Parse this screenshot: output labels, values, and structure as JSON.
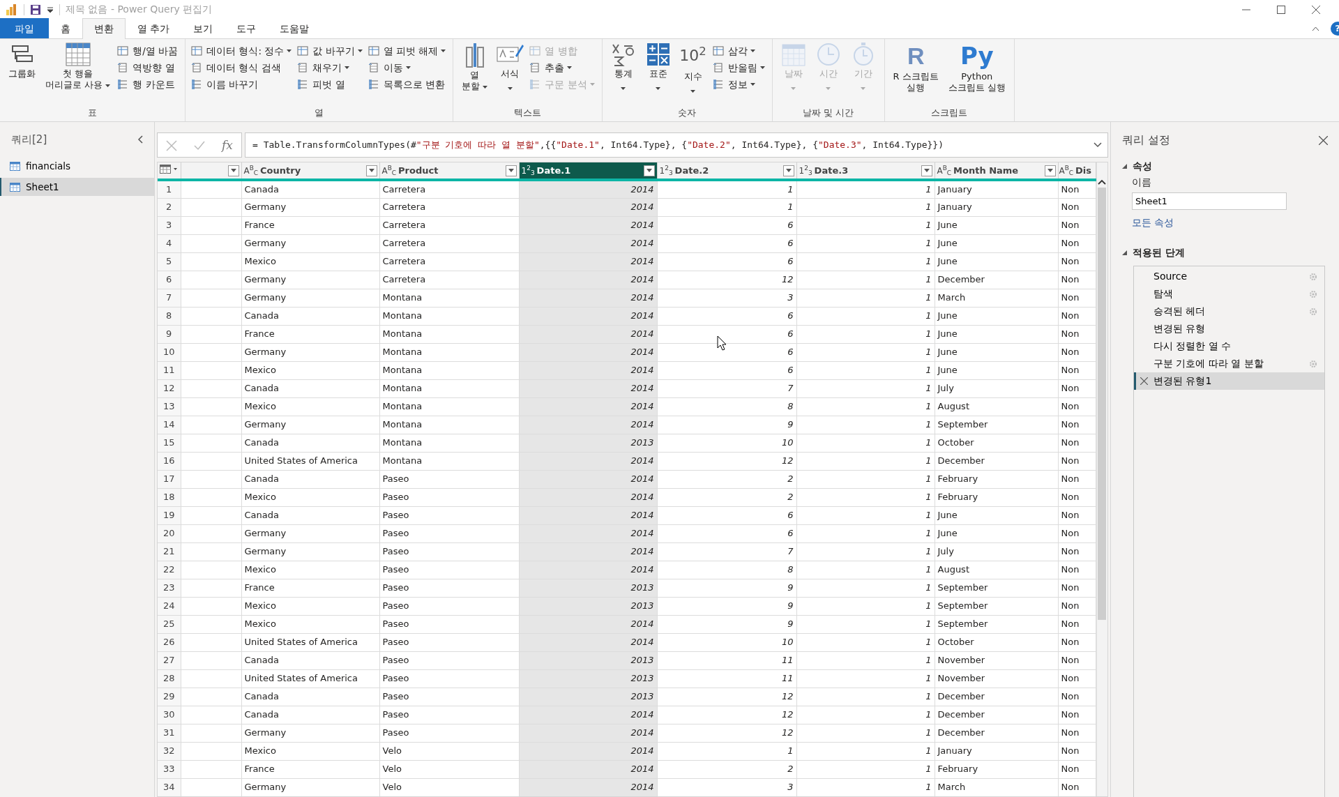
{
  "title_bar": {
    "title": "제목 없음 - Power Query 편집기"
  },
  "ribbon_tabs": [
    {
      "label": "파일",
      "kind": "file",
      "selected": false
    },
    {
      "label": "홈",
      "kind": "tab",
      "selected": false
    },
    {
      "label": "변환",
      "kind": "tab",
      "selected": true
    },
    {
      "label": "열 추가",
      "kind": "tab",
      "selected": false
    },
    {
      "label": "보기",
      "kind": "tab",
      "selected": false
    },
    {
      "label": "도구",
      "kind": "tab",
      "selected": false
    },
    {
      "label": "도움말",
      "kind": "tab",
      "selected": false
    }
  ],
  "help": "?",
  "ribbon_groups": [
    {
      "label": "표",
      "items": [
        {
          "kind": "large",
          "lines": [
            "그룹화"
          ],
          "dropdown": false,
          "disabled": false
        },
        {
          "kind": "large",
          "lines": [
            "첫 행을",
            "머리글로 사용"
          ],
          "dropdown": true,
          "disabled": false
        },
        {
          "kind": "stack",
          "items": [
            {
              "label": "행/열 바꿈",
              "dropdown": false,
              "disabled": false
            },
            {
              "label": "역방향 열",
              "dropdown": false,
              "disabled": false
            },
            {
              "label": "행 카운트",
              "dropdown": false,
              "disabled": false
            }
          ]
        }
      ]
    },
    {
      "label": "열",
      "items": [
        {
          "kind": "stack",
          "items": [
            {
              "label": "데이터 형식: 정수",
              "dropdown": true,
              "disabled": false
            },
            {
              "label": "데이터 형식 검색",
              "dropdown": false,
              "disabled": false
            },
            {
              "label": "이름 바꾸기",
              "dropdown": false,
              "disabled": false
            }
          ]
        },
        {
          "kind": "stack",
          "items": [
            {
              "label": "값 바꾸기",
              "dropdown": true,
              "disabled": false
            },
            {
              "label": "채우기",
              "dropdown": true,
              "disabled": false
            },
            {
              "label": "피벗 열",
              "dropdown": false,
              "disabled": false
            }
          ]
        },
        {
          "kind": "stack",
          "items": [
            {
              "label": "열 피벗 해제",
              "dropdown": true,
              "disabled": false
            },
            {
              "label": "이동",
              "dropdown": true,
              "disabled": false
            },
            {
              "label": "목록으로 변환",
              "dropdown": false,
              "disabled": false
            }
          ]
        }
      ]
    },
    {
      "label": "텍스트",
      "items": [
        {
          "kind": "large",
          "lines": [
            "열",
            "분할"
          ],
          "dropdown": true,
          "disabled": false
        },
        {
          "kind": "large",
          "lines": [
            "서식"
          ],
          "dropdown": true,
          "disabled": false
        },
        {
          "kind": "stack",
          "items": [
            {
              "label": "열 병합",
              "dropdown": false,
              "disabled": true
            },
            {
              "label": "추출",
              "dropdown": true,
              "disabled": false
            },
            {
              "label": "구문 분석",
              "dropdown": true,
              "disabled": true
            }
          ]
        }
      ]
    },
    {
      "label": "숫자",
      "items": [
        {
          "kind": "large",
          "lines": [
            "통계"
          ],
          "dropdown": true,
          "disabled": false
        },
        {
          "kind": "large",
          "lines": [
            "표준"
          ],
          "dropdown": true,
          "disabled": false
        },
        {
          "kind": "large",
          "lines": [
            "지수"
          ],
          "dropdown": true,
          "disabled": false,
          "icon_text": "10$^{2}$"
        },
        {
          "kind": "stack",
          "items": [
            {
              "label": "삼각",
              "dropdown": true,
              "disabled": false
            },
            {
              "label": "반올림",
              "dropdown": true,
              "disabled": false
            },
            {
              "label": "정보",
              "dropdown": true,
              "disabled": false
            }
          ]
        }
      ]
    },
    {
      "label": "날짜 및 시간",
      "items": [
        {
          "kind": "large",
          "lines": [
            "날짜"
          ],
          "dropdown": true,
          "disabled": true
        },
        {
          "kind": "large",
          "lines": [
            "시간"
          ],
          "dropdown": true,
          "disabled": true
        },
        {
          "kind": "large",
          "lines": [
            "기간"
          ],
          "dropdown": true,
          "disabled": true
        }
      ]
    },
    {
      "label": "스크립트",
      "items": [
        {
          "kind": "large",
          "lines": [
            "R 스크립트",
            "실행"
          ],
          "dropdown": false,
          "disabled": false,
          "icon_text": "R"
        },
        {
          "kind": "large",
          "lines": [
            "Python",
            "스크립트 실행"
          ],
          "dropdown": false,
          "disabled": false,
          "icon_text": "Py"
        }
      ]
    }
  ],
  "queries": {
    "title": "쿼리[2]",
    "items": [
      {
        "label": "financials",
        "selected": false
      },
      {
        "label": "Sheet1",
        "selected": true
      }
    ]
  },
  "formula_bar": {
    "fx": "fx",
    "formula": "= Table.TransformColumnTypes(#\"구분 기호에 따라 열 분할\",{{\"Date.1\", Int64.Type}, {\"Date.2\", Int64.Type}, {\"Date.3\", Int64.Type}})"
  },
  "table": {
    "columns": [
      {
        "kind": "blank",
        "selected": false
      },
      {
        "kind": "text",
        "type_label": "A$^{B}$$_{C}$",
        "label": "Country",
        "selected": false
      },
      {
        "kind": "text",
        "type_label": "A$^{B}$$_{C}$",
        "label": "Product",
        "selected": false
      },
      {
        "kind": "number",
        "type_label": "1$^{2}$$_{3}$",
        "label": "Date.1",
        "selected": true
      },
      {
        "kind": "number",
        "type_label": "1$^{2}$$_{3}$",
        "label": "Date.2",
        "selected": false
      },
      {
        "kind": "number",
        "type_label": "1$^{2}$$_{3}$",
        "label": "Date.3",
        "selected": false
      },
      {
        "kind": "text",
        "type_label": "A$^{B}$$_{C}$",
        "label": "Month Name",
        "selected": false
      },
      {
        "kind": "text",
        "type_label": "A$^{B}$$_{C}$",
        "label": "Dis",
        "selected": false
      }
    ],
    "rows": [
      [
        "1",
        "Canada",
        "Carretera",
        "2014",
        "1",
        "1",
        "January",
        "Non"
      ],
      [
        "2",
        "Germany",
        "Carretera",
        "2014",
        "1",
        "1",
        "January",
        "Non"
      ],
      [
        "3",
        "France",
        "Carretera",
        "2014",
        "6",
        "1",
        "June",
        "Non"
      ],
      [
        "4",
        "Germany",
        "Carretera",
        "2014",
        "6",
        "1",
        "June",
        "Non"
      ],
      [
        "5",
        "Mexico",
        "Carretera",
        "2014",
        "6",
        "1",
        "June",
        "Non"
      ],
      [
        "6",
        "Germany",
        "Carretera",
        "2014",
        "12",
        "1",
        "December",
        "Non"
      ],
      [
        "7",
        "Germany",
        "Montana",
        "2014",
        "3",
        "1",
        "March",
        "Non"
      ],
      [
        "8",
        "Canada",
        "Montana",
        "2014",
        "6",
        "1",
        "June",
        "Non"
      ],
      [
        "9",
        "France",
        "Montana",
        "2014",
        "6",
        "1",
        "June",
        "Non"
      ],
      [
        "10",
        "Germany",
        "Montana",
        "2014",
        "6",
        "1",
        "June",
        "Non"
      ],
      [
        "11",
        "Mexico",
        "Montana",
        "2014",
        "6",
        "1",
        "June",
        "Non"
      ],
      [
        "12",
        "Canada",
        "Montana",
        "2014",
        "7",
        "1",
        "July",
        "Non"
      ],
      [
        "13",
        "Mexico",
        "Montana",
        "2014",
        "8",
        "1",
        "August",
        "Non"
      ],
      [
        "14",
        "Germany",
        "Montana",
        "2014",
        "9",
        "1",
        "September",
        "Non"
      ],
      [
        "15",
        "Canada",
        "Montana",
        "2013",
        "10",
        "1",
        "October",
        "Non"
      ],
      [
        "16",
        "United States of America",
        "Montana",
        "2014",
        "12",
        "1",
        "December",
        "Non"
      ],
      [
        "17",
        "Canada",
        "Paseo",
        "2014",
        "2",
        "1",
        "February",
        "Non"
      ],
      [
        "18",
        "Mexico",
        "Paseo",
        "2014",
        "2",
        "1",
        "February",
        "Non"
      ],
      [
        "19",
        "Canada",
        "Paseo",
        "2014",
        "6",
        "1",
        "June",
        "Non"
      ],
      [
        "20",
        "Germany",
        "Paseo",
        "2014",
        "6",
        "1",
        "June",
        "Non"
      ],
      [
        "21",
        "Germany",
        "Paseo",
        "2014",
        "7",
        "1",
        "July",
        "Non"
      ],
      [
        "22",
        "Mexico",
        "Paseo",
        "2014",
        "8",
        "1",
        "August",
        "Non"
      ],
      [
        "23",
        "France",
        "Paseo",
        "2013",
        "9",
        "1",
        "September",
        "Non"
      ],
      [
        "24",
        "Mexico",
        "Paseo",
        "2013",
        "9",
        "1",
        "September",
        "Non"
      ],
      [
        "25",
        "Mexico",
        "Paseo",
        "2014",
        "9",
        "1",
        "September",
        "Non"
      ],
      [
        "26",
        "United States of America",
        "Paseo",
        "2014",
        "10",
        "1",
        "October",
        "Non"
      ],
      [
        "27",
        "Canada",
        "Paseo",
        "2013",
        "11",
        "1",
        "November",
        "Non"
      ],
      [
        "28",
        "United States of America",
        "Paseo",
        "2013",
        "11",
        "1",
        "November",
        "Non"
      ],
      [
        "29",
        "Canada",
        "Paseo",
        "2013",
        "12",
        "1",
        "December",
        "Non"
      ],
      [
        "30",
        "Canada",
        "Paseo",
        "2014",
        "12",
        "1",
        "December",
        "Non"
      ],
      [
        "31",
        "Germany",
        "Paseo",
        "2014",
        "12",
        "1",
        "December",
        "Non"
      ],
      [
        "32",
        "Mexico",
        "Velo",
        "2014",
        "1",
        "1",
        "January",
        "Non"
      ],
      [
        "33",
        "France",
        "Velo",
        "2014",
        "2",
        "1",
        "February",
        "Non"
      ],
      [
        "34",
        "Germany",
        "Velo",
        "2014",
        "3",
        "1",
        "March",
        "Non"
      ]
    ]
  },
  "query_settings": {
    "title": "쿼리 설정",
    "properties_heading": "속성",
    "name_label": "이름",
    "name_value": "Sheet1",
    "all_properties_link": "모든 속성",
    "steps_heading": "적용된 단계",
    "steps": [
      {
        "label": "Source",
        "has_settings": true,
        "selected": false
      },
      {
        "label": "탐색",
        "has_settings": true,
        "selected": false
      },
      {
        "label": "승격된 헤더",
        "has_settings": true,
        "selected": false
      },
      {
        "label": "변경된 유형",
        "has_settings": false,
        "selected": false
      },
      {
        "label": "다시 정렬한 열 수",
        "has_settings": false,
        "selected": false
      },
      {
        "label": "구분 기호에 따라 열 분할",
        "has_settings": true,
        "selected": false
      },
      {
        "label": "변경된 유형1",
        "has_settings": false,
        "selected": true
      }
    ]
  }
}
